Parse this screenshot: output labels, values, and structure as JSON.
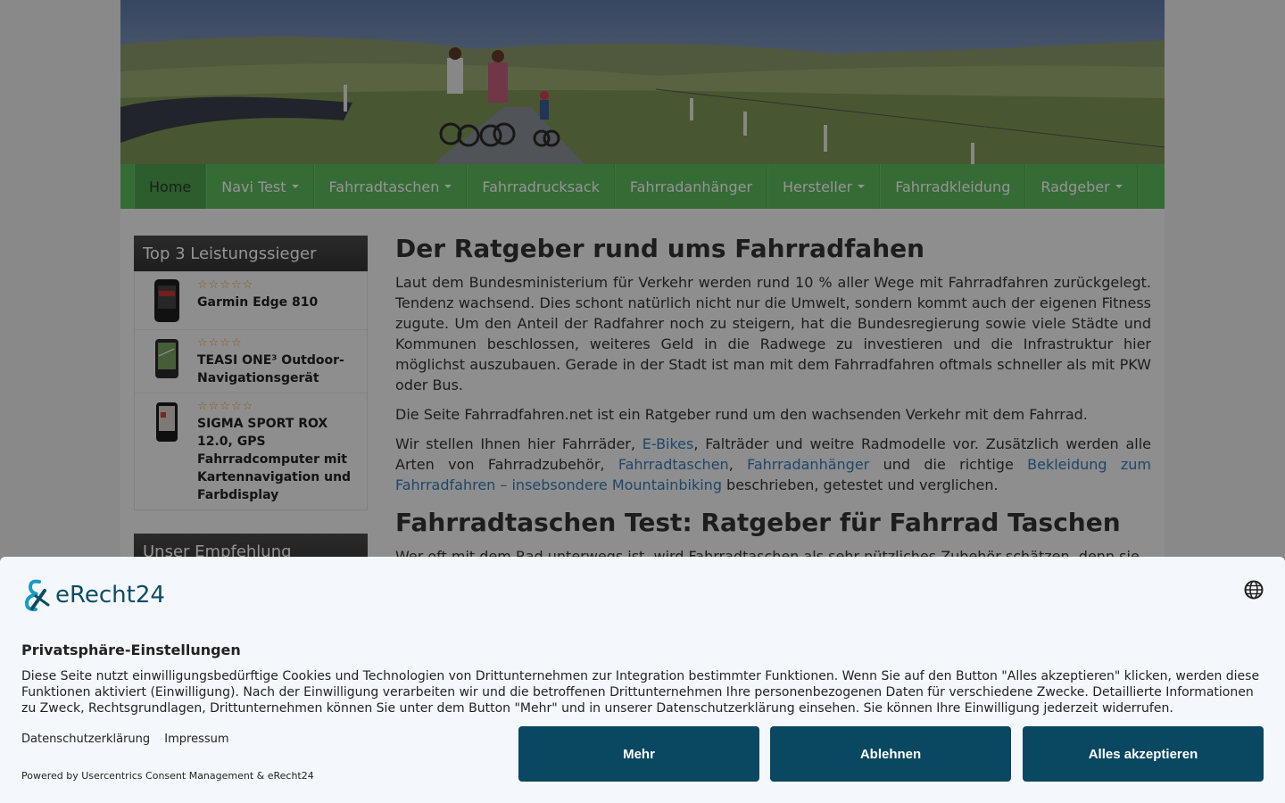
{
  "nav": {
    "items": [
      {
        "label": "Home",
        "dropdown": false,
        "active": true
      },
      {
        "label": "Navi Test",
        "dropdown": true
      },
      {
        "label": "Fahrradtaschen",
        "dropdown": true
      },
      {
        "label": "Fahrradrucksack",
        "dropdown": false
      },
      {
        "label": "Fahrradanhänger",
        "dropdown": false
      },
      {
        "label": "Hersteller",
        "dropdown": true
      },
      {
        "label": "Fahrradkleidung",
        "dropdown": false
      },
      {
        "label": "Radgeber",
        "dropdown": true
      }
    ]
  },
  "sidebar": {
    "top3_title": "Top 3 Leistungssieger",
    "products": [
      {
        "stars": "☆☆☆☆☆",
        "name": "Garmin Edge 810"
      },
      {
        "stars": "☆☆☆☆",
        "name": "TEASI ONE³ Outdoor-Navigationsgerät"
      },
      {
        "stars": "☆☆☆☆☆",
        "name": "SIGMA SPORT ROX 12.0, GPS Fahrradcomputer mit Kartennavigation und Farbdisplay"
      }
    ],
    "recommend_title": "Unser Empfehlung"
  },
  "content": {
    "h1": "Der Ratgeber rund ums Fahrradfahen",
    "p1": "Laut dem Bundesministerium für Verkehr werden rund 10 % aller Wege mit Fahrradfahren zurückgelegt. Tendenz wachsend. Dies schont natürlich nicht nur die Umwelt, sondern kommt auch der eigenen Fitness zugute. Um den Anteil der Radfahrer noch zu steigern, hat die Bundesregierung sowie viele Städte und Kommunen beschlossen, weiteres Geld in die Radwege zu investieren und die Infrastruktur hier möglichst auszubauen. Gerade in der Stadt ist man mit dem Fahrradfahren oftmals schneller als mit PKW oder Bus.",
    "p2": "Die Seite Fahrradfahren.net ist ein Ratgeber rund um den wachsenden Verkehr mit dem Fahrrad.",
    "p3_a": "Wir stellen Ihnen hier Fahrräder, ",
    "p3_link1": "E-Bikes",
    "p3_b": ", Falträder und weitre Radmodelle vor. Zusätzlich werden alle Arten von Fahrradzubehör, ",
    "p3_link2": "Fahrradtaschen",
    "p3_c": ", ",
    "p3_link3": "Fahrradanhänger",
    "p3_d": " und die richtige ",
    "p3_link4": "Bekleidung zum Fahrradfahren – insebsondere Mountainbiking",
    "p3_e": "  beschrieben, getestet und verglichen.",
    "h2": "Fahrradtaschen Test: Ratgeber für Fahrrad Taschen",
    "p4": "Wer oft mit dem Rad unterwegs ist, wird Fahrradtaschen als sehr nützliches Zubehör schätzen, denn sie"
  },
  "consent": {
    "logo_text": "eRecht24",
    "title": "Privatsphäre-Einstellungen",
    "text": "Diese Seite nutzt einwilligungsbedürftige Cookies und Technologien von Drittunternehmen zur Integration bestimmter Funktionen. Wenn Sie auf den Button \"Alles akzeptieren\" klicken, werden diese Funktionen aktiviert (Einwilligung). Nach der Einwilligung verarbeiten wir und die betroffenen Drittunternehmen Ihre personenbezogenen Daten für verschiedene Zwecke. Detaillierte Informationen zu Zweck, Rechtsgrundlagen, Drittunternehmen können Sie unter dem Button \"Mehr\" und in unserer Datenschutzerklärung einsehen. Sie können Ihre Einwilligung jederzeit widerrufen.",
    "link_privacy": "Datenschutzerklärung",
    "link_imprint": "Impressum",
    "powered": "Powered by Usercentrics Consent Management & eRecht24",
    "btn_more": "Mehr",
    "btn_decline": "Ablehnen",
    "btn_accept": "Alles akzeptieren"
  },
  "colors": {
    "nav_green": "#5cb85c",
    "button": "#0a4760",
    "link": "#337ab7"
  }
}
